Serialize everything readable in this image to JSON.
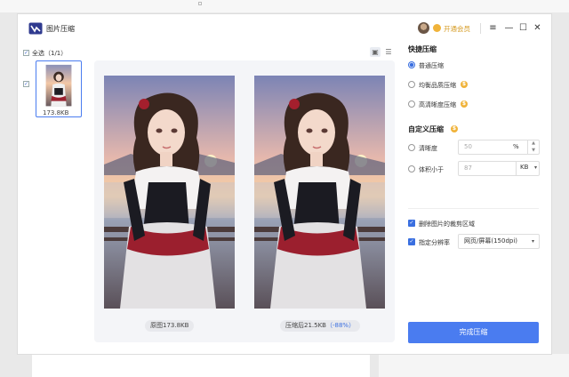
{
  "app": {
    "title": "图片压缩",
    "vip_label": "开通会员"
  },
  "window_controls": {
    "menu": "≡",
    "minimize": "—",
    "maximize": "☐",
    "close": "✕"
  },
  "file_list": {
    "select_all_label": "全选（1/1）",
    "items": [
      {
        "size": "173.8KB",
        "checked": true
      }
    ]
  },
  "preview": {
    "original_caption": "原图173.8KB",
    "compressed_caption_prefix": "压缩后21.5KB",
    "compressed_ratio": "（-88%）"
  },
  "quick_compress": {
    "title": "快捷压缩",
    "options": [
      {
        "label": "普通压缩",
        "selected": true,
        "vip": false
      },
      {
        "label": "均衡品质压缩",
        "selected": false,
        "vip": true
      },
      {
        "label": "高清晰度压缩",
        "selected": false,
        "vip": true
      }
    ]
  },
  "custom_compress": {
    "title": "自定义压缩",
    "clarity": {
      "label": "清晰度",
      "value": "50",
      "unit": "%"
    },
    "size_limit": {
      "label": "体积小于",
      "value": "87",
      "unit": "KB"
    }
  },
  "options": {
    "remove_crop": {
      "label": "删除图片的裁剪区域",
      "checked": true
    },
    "resolution": {
      "label": "指定分辨率",
      "checked": true,
      "value": "网页/屏幕(150dpi)"
    }
  },
  "actions": {
    "complete_label": "完成压缩"
  },
  "colors": {
    "accent": "#4a7cf0",
    "vip": "#f0b33a",
    "ratio": "#3a6fe0"
  }
}
